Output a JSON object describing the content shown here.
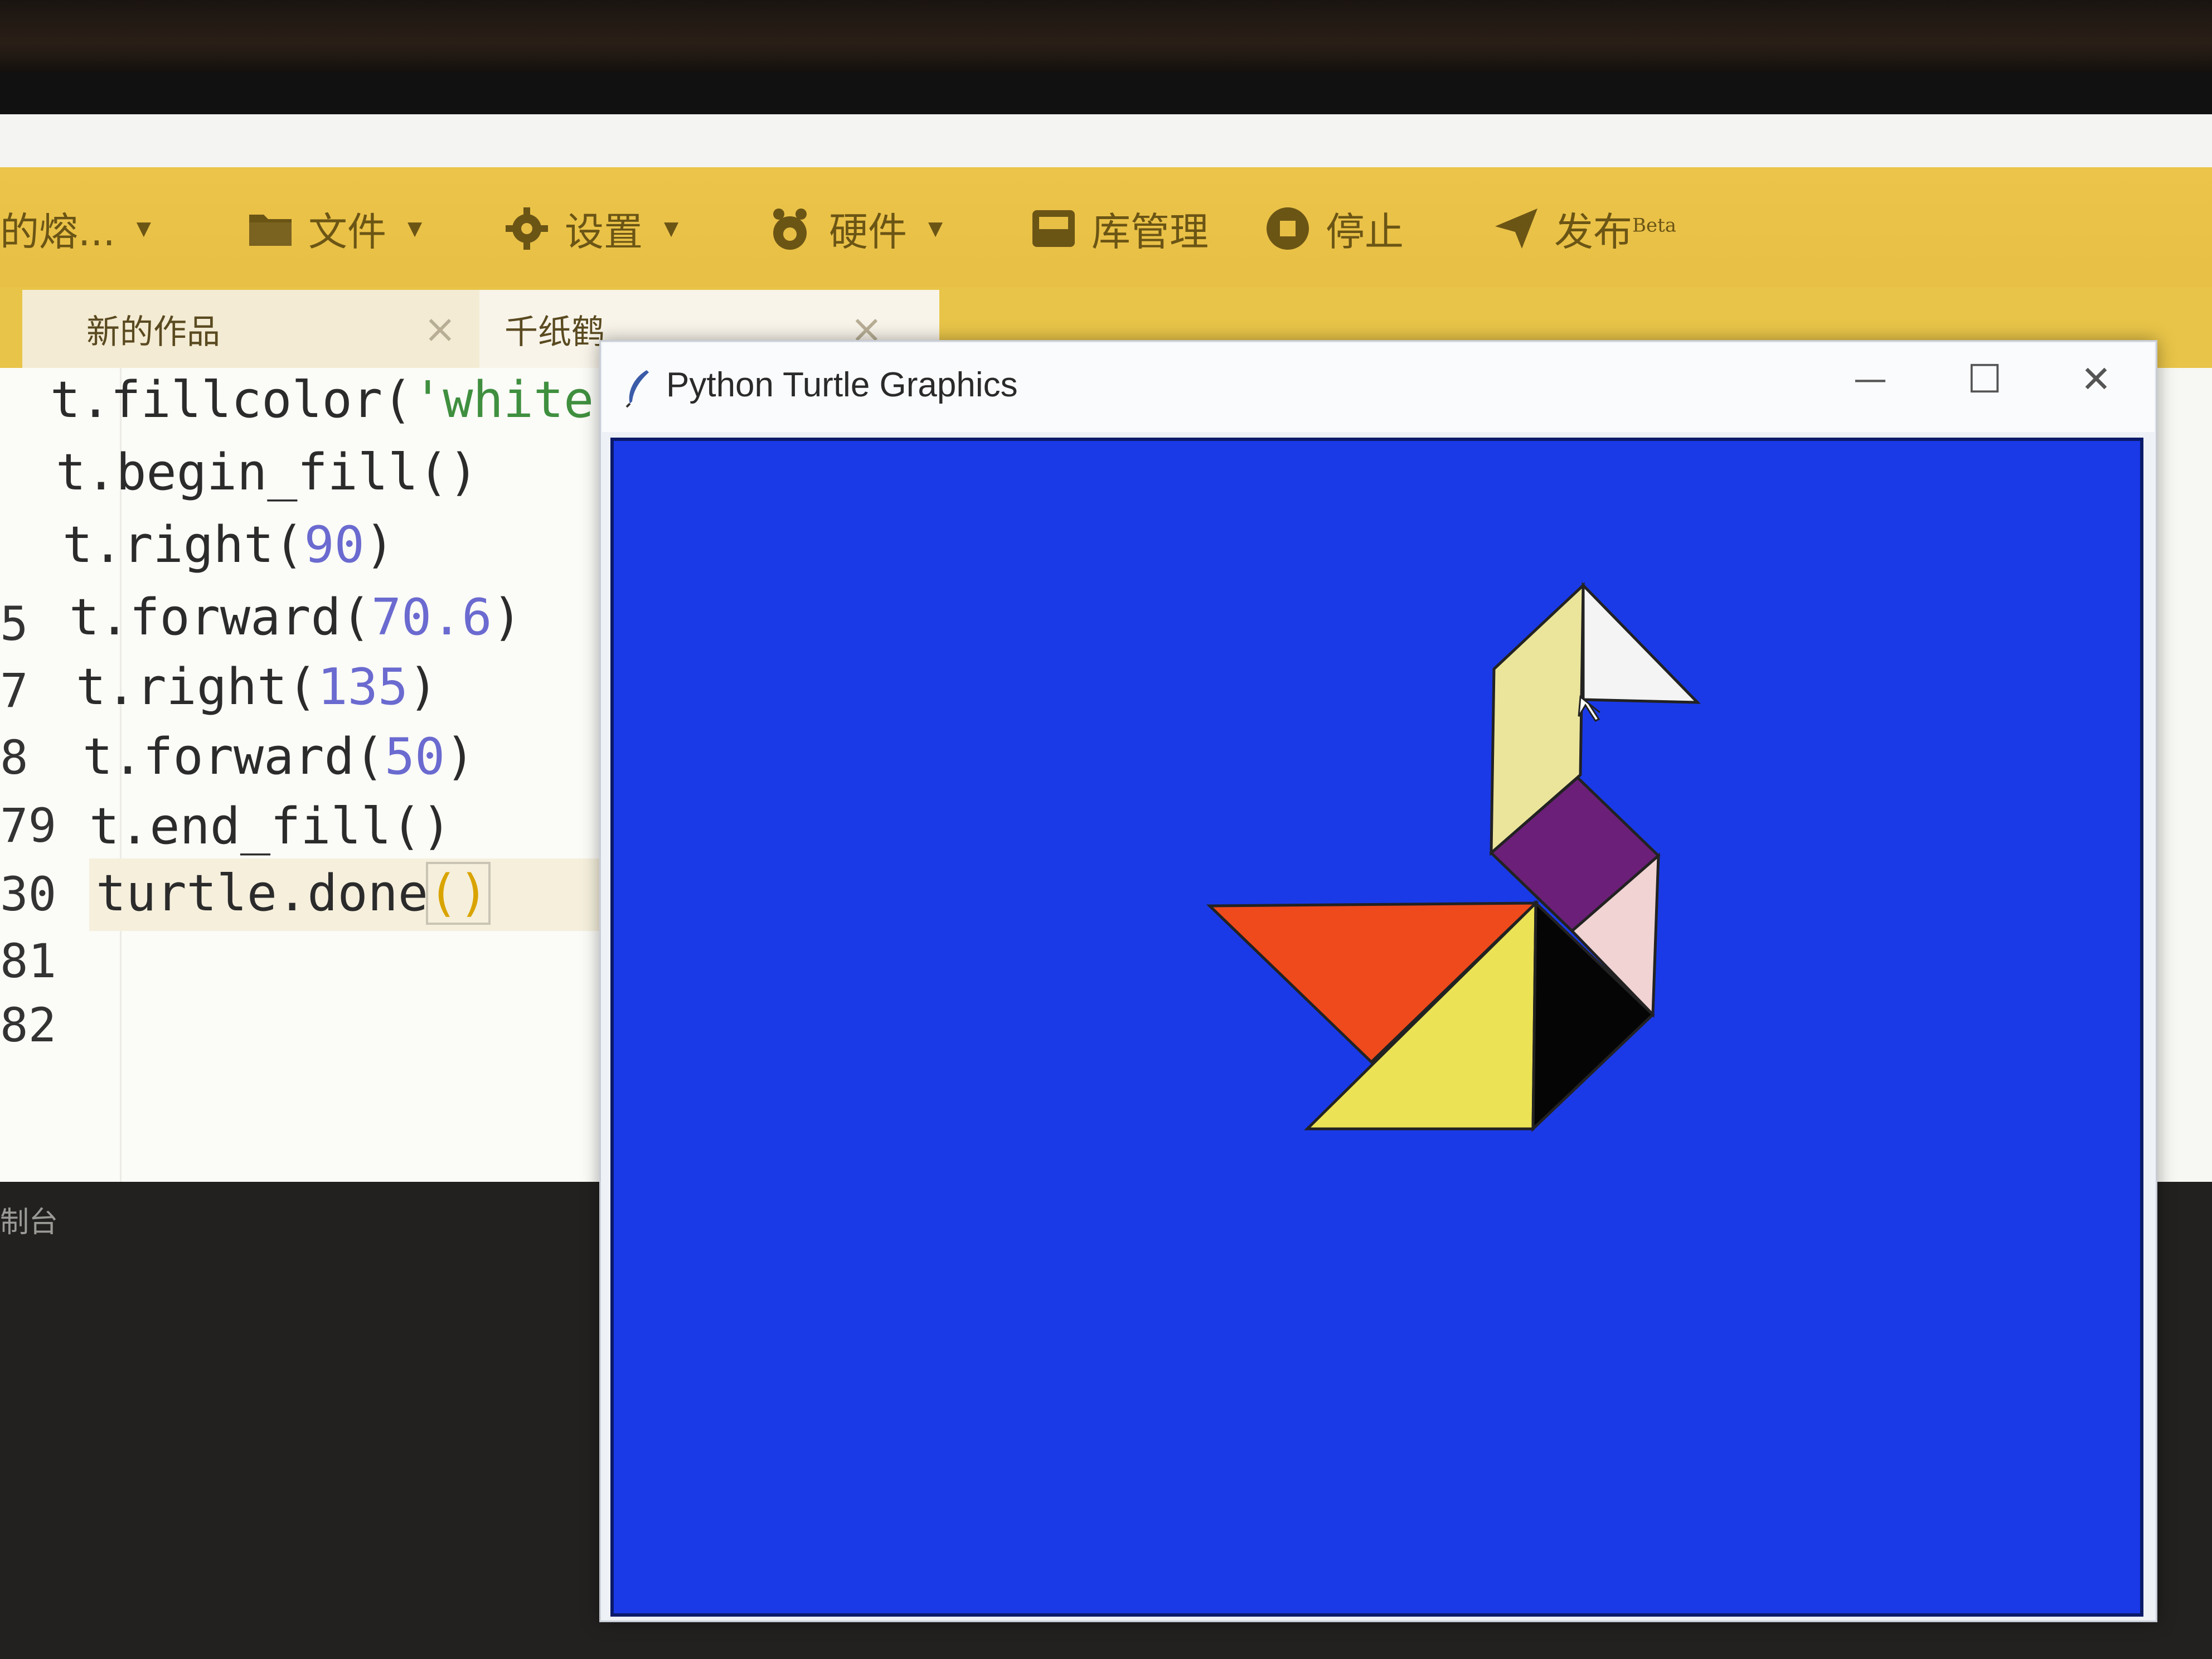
{
  "app": {
    "toolbar": {
      "project": "的熔...",
      "file": "文件",
      "settings": "设置",
      "hardware": "硬件",
      "library": "库管理",
      "stop": "停止",
      "publish": "发布",
      "publish_badge": "Beta"
    },
    "tabs": [
      {
        "label": "新的作品",
        "close": "×"
      },
      {
        "label": "千纸鹤",
        "close": "×"
      }
    ],
    "editor": {
      "line_numbers": [
        "5",
        "7",
        "8",
        "79",
        "30",
        "81",
        "82"
      ],
      "lines": [
        {
          "a": "t.fillcolor(",
          "str": "'white'",
          "b": ")"
        },
        {
          "a": "t.begin_fill()"
        },
        {
          "a": "t.right(",
          "num": "90",
          "b": ")"
        },
        {
          "a": "t.forward(",
          "num": "70.6",
          "b": ")"
        },
        {
          "a": "t.right(",
          "num": "135",
          "b": ")"
        },
        {
          "a": "t.forward(",
          "num": "50",
          "b": ")"
        },
        {
          "a": "t.end_fill()"
        },
        {
          "a": "turtle.done",
          "paren": "()"
        }
      ]
    },
    "console_label": "制台"
  },
  "turtle_window": {
    "title": "Python Turtle Graphics",
    "buttons": {
      "minimize": "—",
      "maximize": "☐",
      "close": "✕"
    },
    "canvas_bg": "#1a3ae8",
    "pieces": [
      {
        "name": "neck",
        "color": "#ebe59c"
      },
      {
        "name": "head",
        "color": "#f4f4f4"
      },
      {
        "name": "purple-square",
        "color": "#6c1f78"
      },
      {
        "name": "pink-triangle",
        "color": "#f1d3d3"
      },
      {
        "name": "red-triangle",
        "color": "#ef4a1c"
      },
      {
        "name": "yellow-triangle",
        "color": "#ece255"
      },
      {
        "name": "black-triangle",
        "color": "#050505"
      }
    ]
  }
}
